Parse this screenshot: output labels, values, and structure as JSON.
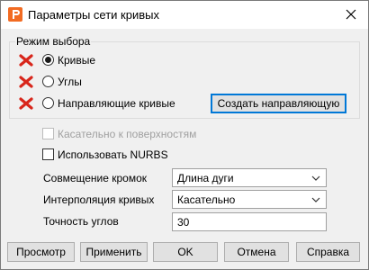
{
  "window": {
    "title": "Параметры сети кривых"
  },
  "selection_mode": {
    "group_title": "Режим выбора",
    "options": [
      {
        "label": "Кривые",
        "checked": true
      },
      {
        "label": "Углы",
        "checked": false
      },
      {
        "label": "Направляющие кривые",
        "checked": false
      }
    ],
    "create_guide_button": "Создать направляющую"
  },
  "options": {
    "tangent_to_surfaces": "Касательно к поверхностям",
    "use_nurbs": "Использовать NURBS"
  },
  "fields": {
    "edge_matching_label": "Совмещение кромок",
    "edge_matching_value": "Длина дуги",
    "curve_interpolation_label": "Интерполяция кривых",
    "curve_interpolation_value": "Касательно",
    "angle_precision_label": "Точность углов",
    "angle_precision_value": "30"
  },
  "buttons": {
    "preview": "Просмотр",
    "apply": "Применить",
    "ok": "OK",
    "cancel": "Отмена",
    "help": "Справка"
  },
  "colors": {
    "accent": "#0078d7",
    "error_icon": "#d8261b",
    "app_icon": "#f26b22"
  },
  "icons": {
    "app": "app-logo-icon",
    "close": "close-icon",
    "status": "error-x-icon",
    "dropdown": "chevron-down-icon"
  }
}
